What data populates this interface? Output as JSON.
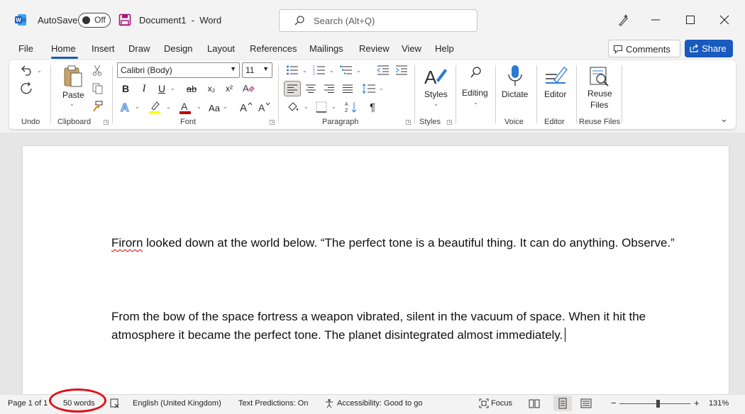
{
  "colors": {
    "accent": "#185abd",
    "highlight": "#ffff00",
    "font_color": "#c00000",
    "annotation": "#e0101a"
  },
  "titlebar": {
    "autosave_label": "AutoSave",
    "toggle_state": "Off",
    "doc_title": "Document1  -  Word",
    "search_placeholder": "Search (Alt+Q)"
  },
  "tabs": [
    "File",
    "Home",
    "Insert",
    "Draw",
    "Design",
    "Layout",
    "References",
    "Mailings",
    "Review",
    "View",
    "Help"
  ],
  "active_tab": "Home",
  "actions": {
    "comments": "Comments",
    "share": "Share"
  },
  "ribbon": {
    "groups": [
      "Undo",
      "Clipboard",
      "Font",
      "Paragraph",
      "Styles",
      "Voice",
      "Editor",
      "Reuse Files"
    ],
    "paste": "Paste",
    "font_name": "Calibri (Body)",
    "font_size": "11",
    "styles": "Styles",
    "editing": "Editing",
    "dictate": "Dictate",
    "editor": "Editor",
    "reuse_files_1": "Reuse",
    "reuse_files_2": "Files",
    "font_buttons": [
      "B",
      "I",
      "U",
      "ab",
      "x₂",
      "x²"
    ],
    "case_btn": "Aa"
  },
  "document": {
    "para1_word1": "Firorn",
    "para1_rest": " looked down at the world below. “The perfect tone is a beautiful thing. It can do anything. Observe.”",
    "para2": "From the bow of the space fortress a weapon vibrated, silent in the vacuum of space. When it hit the atmosphere it became the perfect tone. The planet disintegrated almost immediately."
  },
  "status": {
    "page": "Page 1 of 1",
    "words": "50 words",
    "language": "English (United Kingdom)",
    "predictions": "Text Predictions: On",
    "accessibility": "Accessibility: Good to go",
    "focus": "Focus",
    "zoom": "131%"
  }
}
